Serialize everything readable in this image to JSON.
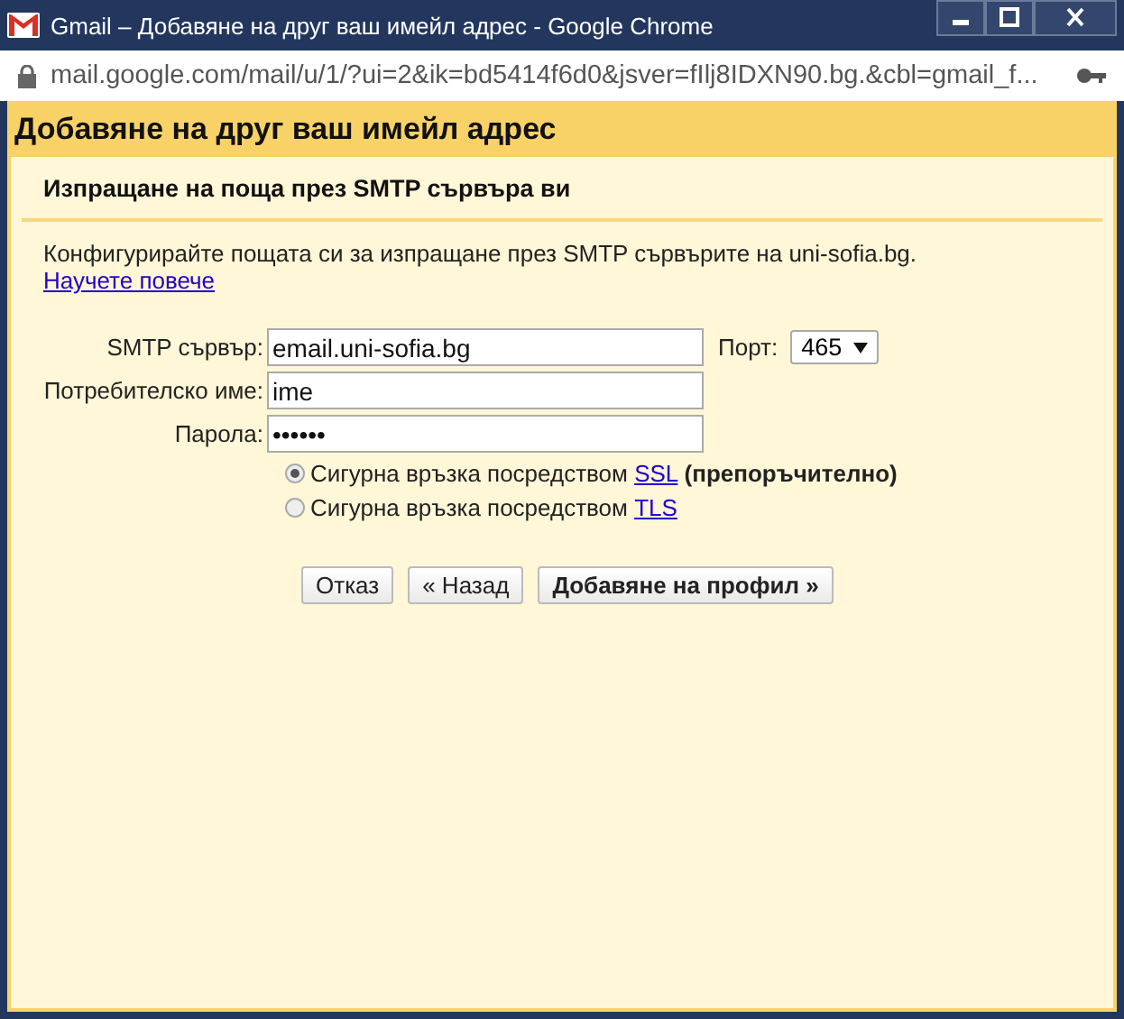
{
  "window": {
    "title": "Gmail – Добавяне на друг ваш имейл адрес - Google Chrome"
  },
  "address_bar": {
    "url": "mail.google.com/mail/u/1/?ui=2&ik=bd5414f6d0&jsver=fIlj8IDXN90.bg.&cbl=gmail_f..."
  },
  "dialog": {
    "title": "Добавяне на друг ваш имейл адрес",
    "subtitle": "Изпращане на поща през SMTP сървъра ви",
    "description": {
      "text": "Конфигурирайте пощата си за изпращане през SMTP сървърите на uni-sofia.bg.",
      "link": "Научете повече"
    },
    "fields": [
      {
        "label": "SMTP сървър:",
        "value": "email.uni-sofia.bg"
      },
      {
        "label": "Потребителско име:",
        "value": "ime"
      },
      {
        "label": "Парола:",
        "value": "••••••"
      }
    ],
    "port": {
      "label": "Порт:",
      "value": "465"
    },
    "security_options": [
      {
        "label": "Сигурна връзка посредством",
        "link": "SSL",
        "note": "(препоръчително)",
        "selected": true
      },
      {
        "label": "Сигурна връзка посредством",
        "link": "TLS",
        "selected": false
      }
    ],
    "buttons": [
      {
        "label": "Отказ",
        "kind": "normal"
      },
      {
        "label": "« Назад",
        "kind": "normal"
      },
      {
        "label": "Добавяне на профил »",
        "kind": "primary"
      }
    ]
  }
}
